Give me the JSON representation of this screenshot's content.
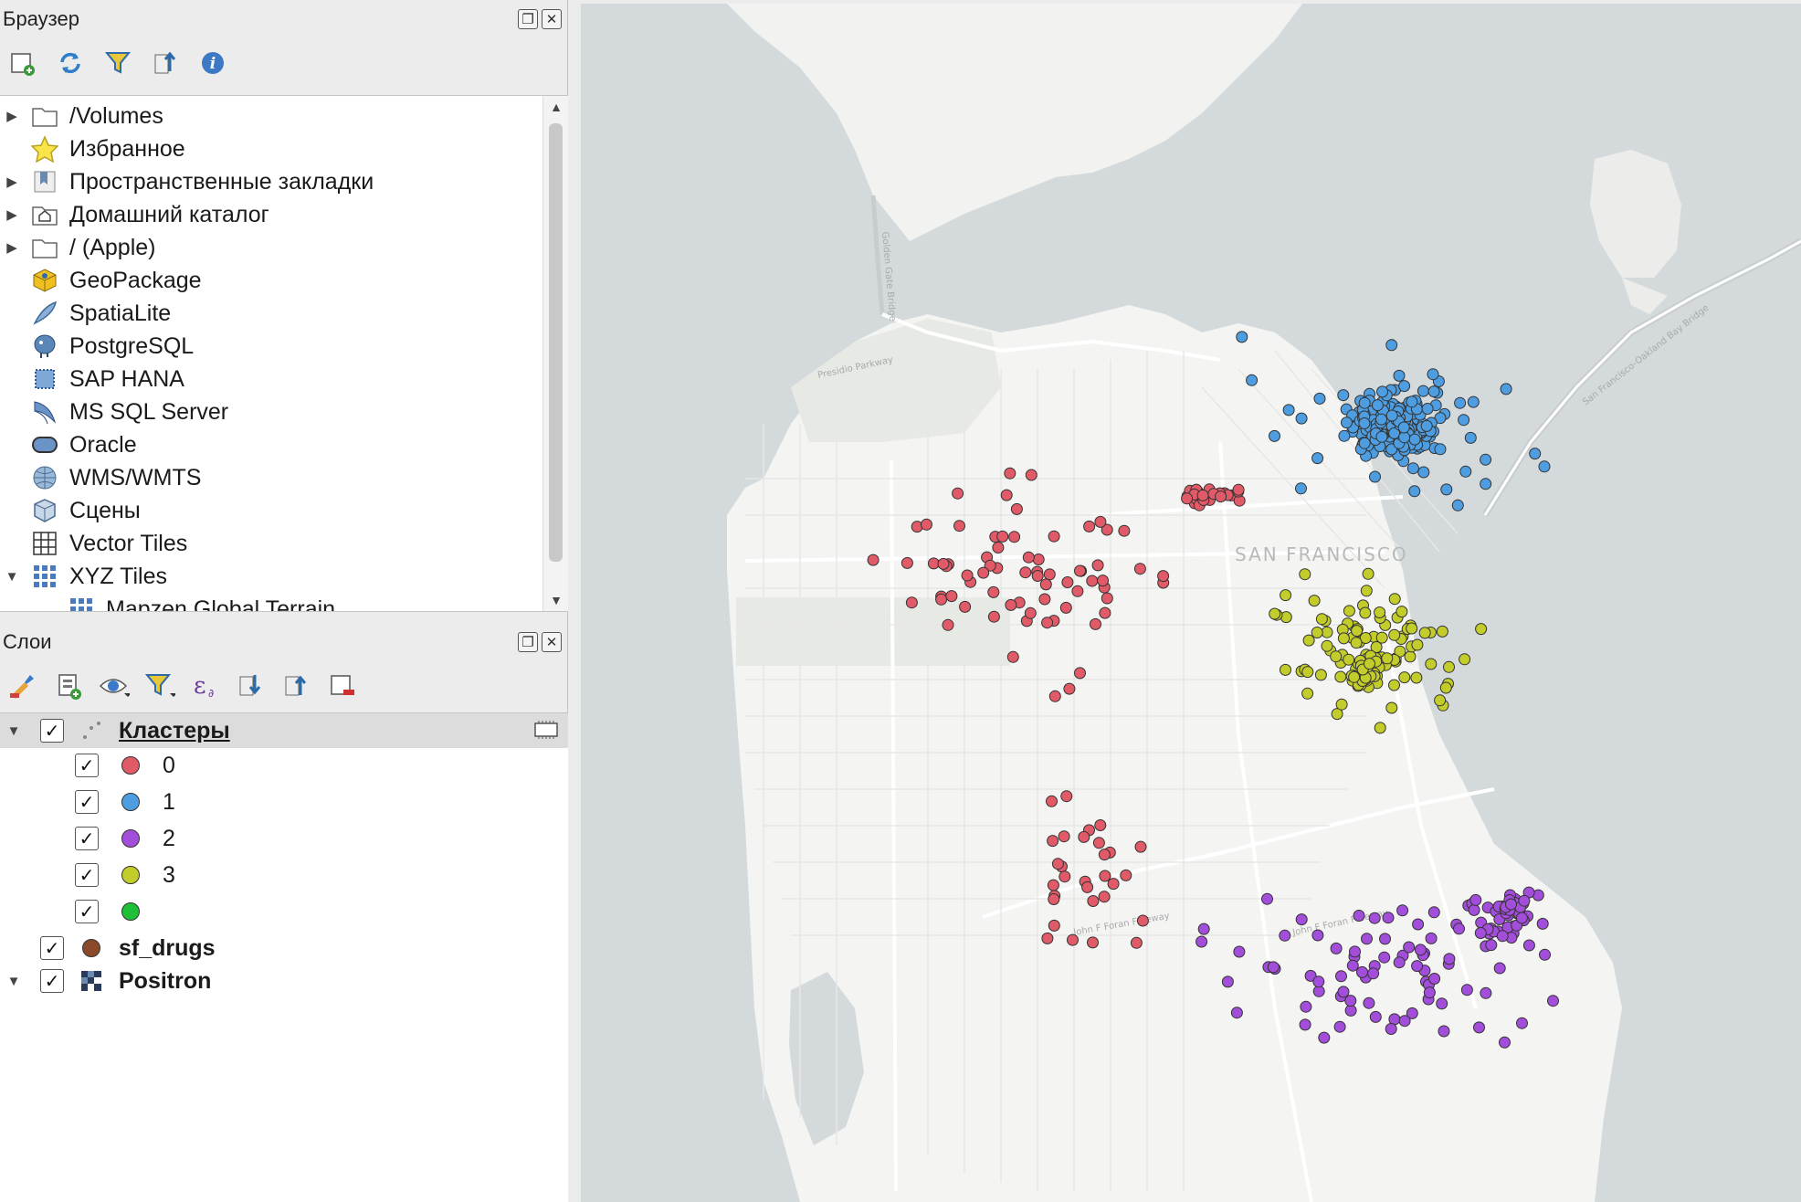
{
  "browser": {
    "title": "Браузер",
    "items": [
      {
        "label": "/Volumes",
        "expandable": true,
        "icon": "folder-icon"
      },
      {
        "label": "Избранное",
        "expandable": false,
        "icon": "star-icon"
      },
      {
        "label": "Пространственные закладки",
        "expandable": true,
        "icon": "bookmark-icon"
      },
      {
        "label": "Домашний каталог",
        "expandable": true,
        "icon": "home-folder-icon"
      },
      {
        "label": "/ (Apple)",
        "expandable": true,
        "icon": "folder-icon"
      },
      {
        "label": "GeoPackage",
        "expandable": false,
        "icon": "geopackage-icon"
      },
      {
        "label": "SpatiaLite",
        "expandable": false,
        "icon": "spatialite-icon"
      },
      {
        "label": "PostgreSQL",
        "expandable": false,
        "icon": "postgresql-icon"
      },
      {
        "label": "SAP HANA",
        "expandable": false,
        "icon": "sap-hana-icon"
      },
      {
        "label": "MS SQL Server",
        "expandable": false,
        "icon": "mssql-icon"
      },
      {
        "label": "Oracle",
        "expandable": false,
        "icon": "oracle-icon"
      },
      {
        "label": "WMS/WMTS",
        "expandable": false,
        "icon": "wms-icon"
      },
      {
        "label": "Сцены",
        "expandable": false,
        "icon": "scenes-icon"
      },
      {
        "label": "Vector Tiles",
        "expandable": false,
        "icon": "vector-tiles-icon"
      },
      {
        "label": "XYZ Tiles",
        "expandable": true,
        "expanded": true,
        "icon": "xyz-tiles-icon"
      },
      {
        "label": "Mapzen Global Terrain",
        "expandable": false,
        "icon": "xyz-tiles-icon",
        "child": true
      }
    ]
  },
  "layers": {
    "title": "Слои",
    "group": {
      "label": "Кластеры",
      "checked": true
    },
    "classes": [
      {
        "label": "0",
        "color": "#e05a68"
      },
      {
        "label": "1",
        "color": "#4d9de0"
      },
      {
        "label": "2",
        "color": "#a34ddb"
      },
      {
        "label": "3",
        "color": "#c2cc2b"
      },
      {
        "label": "",
        "color": "#1fbf38"
      }
    ],
    "other_layers": [
      {
        "label": "sf_drugs",
        "color": "#8a4a2a",
        "icon": "point-layer-icon"
      },
      {
        "label": "Positron",
        "icon": "raster-layer-icon"
      }
    ]
  },
  "map": {
    "water_color": "#d4dadc",
    "land_color": "#f4f4f2",
    "park_color": "#e6e9e4",
    "road_labels": [
      "Presidio Parkway",
      "Golden Gate Bridge",
      "John F Foran Freeway",
      "San Francisco-Oakland Bay Bridge"
    ],
    "city_label": "SAN FRANCISCO",
    "clusters": {
      "0": "#e05a68",
      "1": "#4d9de0",
      "2": "#a34ddb",
      "3": "#c2cc2b"
    }
  }
}
